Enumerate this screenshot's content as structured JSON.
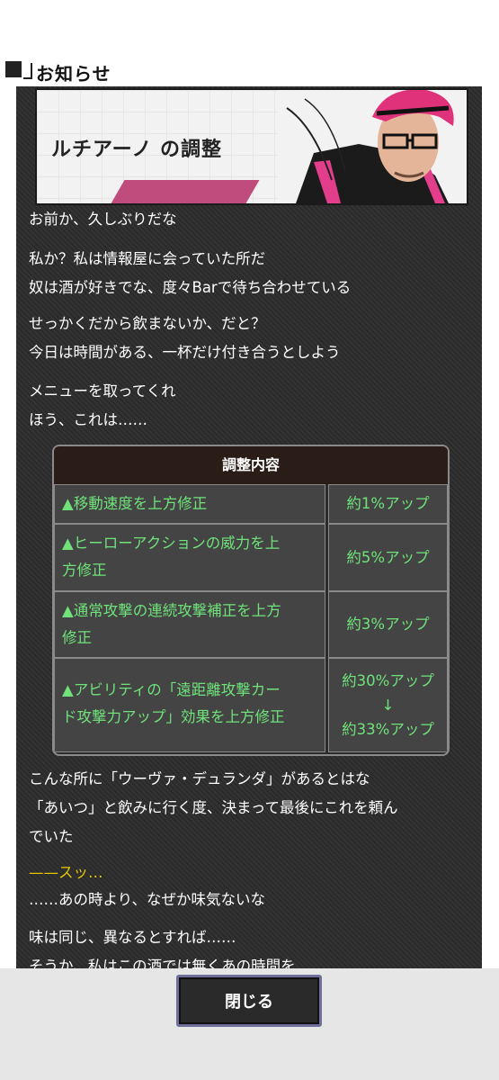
{
  "header": {
    "title": "お知らせ"
  },
  "banner": {
    "title": "ルチアーノ の調整"
  },
  "paragraphs": [
    {
      "lines": [
        "お前か、久しぶりだな"
      ]
    },
    {
      "lines": [
        "私か？私は情報屋に会っていた所だ",
        "奴は酒が好きでな、度々Barで待ち合わせている"
      ]
    },
    {
      "lines": [
        "せっかくだから飲まないか、だと？",
        "今日は時間がある、一杯だけ付き合うとしよう"
      ]
    },
    {
      "lines": [
        "メニューを取ってくれ",
        "ほう、これは……"
      ]
    }
  ],
  "table": {
    "header": "調整内容",
    "rows": [
      {
        "item": [
          "▲移動速度を上方修正"
        ],
        "value": [
          "約1%アップ"
        ]
      },
      {
        "item": [
          "▲ヒーローアクションの威力を上",
          "方修正"
        ],
        "value": [
          "約5%アップ"
        ]
      },
      {
        "item": [
          "▲通常攻撃の連続攻撃補正を上方",
          "修正"
        ],
        "value": [
          "約3%アップ"
        ]
      },
      {
        "item": [
          "▲アビリティの「遠距離攻撃カー",
          "ド攻撃力アップ」効果を上方修正"
        ],
        "value": [
          "約30%アップ",
          "↓",
          "約33%アップ"
        ]
      }
    ]
  },
  "after": [
    {
      "lines": [
        "こんな所に「ウーヴァ・デュランダ」があるとはな",
        "「あいつ」と飲みに行く度、決まって最後にこれを頼ん",
        "でいた"
      ]
    },
    {
      "lines": [
        "——スッ…"
      ],
      "color": "#e5c800"
    },
    {
      "lines": [
        "……あの時より、なぜか味気ないな"
      ]
    },
    {
      "lines": [
        "味は同じ、異なるとすれば……",
        "そうか、私はこの酒では無くあの時間を……"
      ]
    }
  ],
  "footer": {
    "close_label": "閉じる"
  },
  "colors": {
    "accent_green": "#6fe37a",
    "accent_yellow": "#e5c800",
    "table_header": "#2a1c16"
  }
}
